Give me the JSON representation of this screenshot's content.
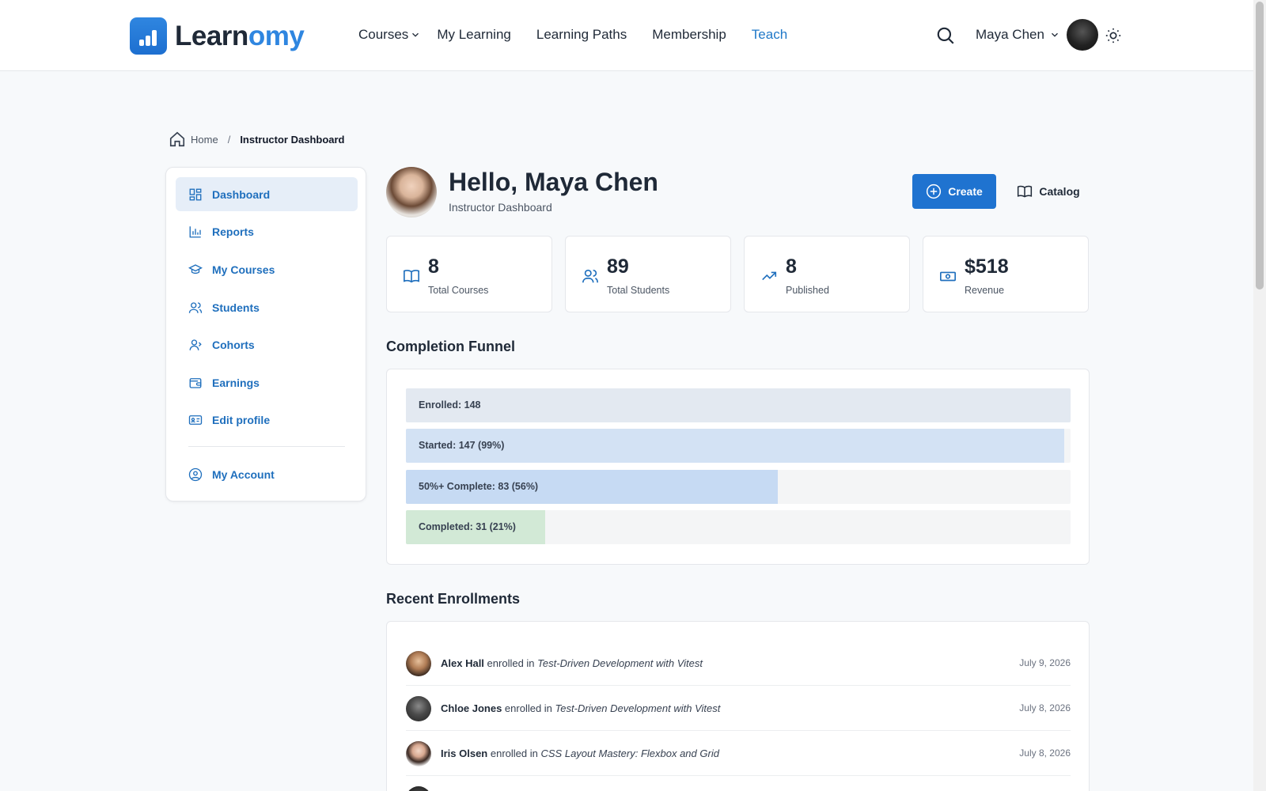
{
  "brand": {
    "word_dark": "Learn",
    "word_accent": "omy",
    "accent_color": "#2f86e0"
  },
  "nav": {
    "items": [
      {
        "label": "Courses",
        "has_dropdown": true,
        "active": false
      },
      {
        "label": "My Learning",
        "active": false
      },
      {
        "label": "Learning Paths",
        "active": false
      },
      {
        "label": "Membership",
        "active": false
      },
      {
        "label": "Teach",
        "active": true
      }
    ],
    "user_name": "Maya Chen",
    "icons": [
      "search-icon",
      "chevron-down-icon",
      "sun-icon"
    ]
  },
  "breadcrumb": {
    "home": "Home",
    "separator": "/",
    "current": "Instructor Dashboard"
  },
  "sidebar": {
    "items": [
      {
        "label": "Dashboard",
        "icon": "dashboard-icon",
        "active": true
      },
      {
        "label": "Reports",
        "icon": "bar-chart-icon"
      },
      {
        "label": "My Courses",
        "icon": "graduation-cap-icon"
      },
      {
        "label": "Students",
        "icon": "users-icon"
      },
      {
        "label": "Cohorts",
        "icon": "user-group-icon"
      },
      {
        "label": "Earnings",
        "icon": "wallet-icon"
      },
      {
        "label": "Edit profile",
        "icon": "id-card-icon"
      },
      {
        "label": "My Account",
        "icon": "user-circle-icon"
      }
    ]
  },
  "header": {
    "greeting": "Hello, Maya Chen",
    "subtitle": "Instructor Dashboard",
    "create_label": "Create",
    "catalog_label": "Catalog"
  },
  "stats": [
    {
      "value": "8",
      "label": "Total Courses",
      "icon": "book-open-icon"
    },
    {
      "value": "89",
      "label": "Total Students",
      "icon": "users-icon"
    },
    {
      "value": "8",
      "label": "Published",
      "icon": "trending-up-icon"
    },
    {
      "value": "$518",
      "label": "Revenue",
      "icon": "banknote-icon"
    }
  ],
  "funnel": {
    "title": "Completion Funnel",
    "rows": [
      {
        "label": "Enrolled: 148",
        "fraction": 1.0,
        "color": "#e3e9f1"
      },
      {
        "label": "Started: 147 (99%)",
        "fraction": 0.99,
        "color": "#d3e2f4"
      },
      {
        "label": "50%+ Complete: 83 (56%)",
        "fraction": 0.56,
        "color": "#c6daf3"
      },
      {
        "label": "Completed: 31 (21%)",
        "fraction": 0.21,
        "color": "#d2e9d6"
      }
    ]
  },
  "enrollments": {
    "title": "Recent Enrollments",
    "connector": "enrolled in",
    "rows": [
      {
        "name": "Alex Hall",
        "course": "Test-Driven Development with Vitest",
        "date": "July 9, 2026"
      },
      {
        "name": "Chloe Jones",
        "course": "Test-Driven Development with Vitest",
        "date": "July 8, 2026"
      },
      {
        "name": "Iris Olsen",
        "course": "CSS Layout Mastery: Flexbox and Grid",
        "date": "July 8, 2026"
      }
    ]
  }
}
